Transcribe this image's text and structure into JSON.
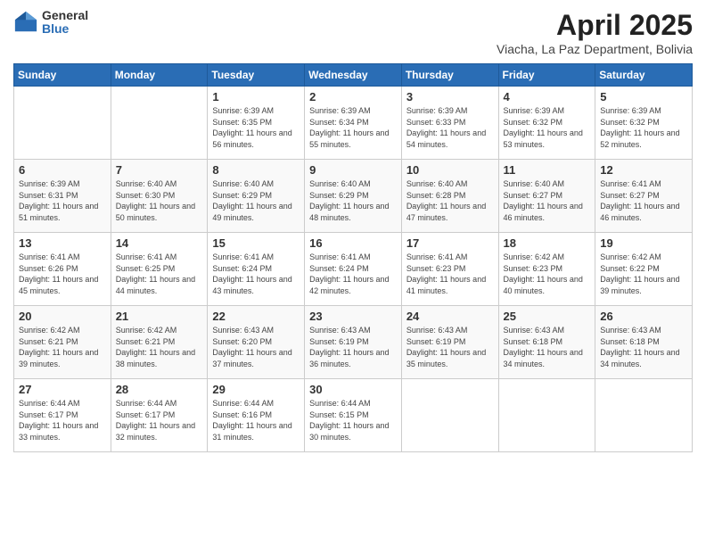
{
  "logo": {
    "general": "General",
    "blue": "Blue"
  },
  "header": {
    "month": "April 2025",
    "location": "Viacha, La Paz Department, Bolivia"
  },
  "weekdays": [
    "Sunday",
    "Monday",
    "Tuesday",
    "Wednesday",
    "Thursday",
    "Friday",
    "Saturday"
  ],
  "weeks": [
    [
      {
        "day": null,
        "sunrise": null,
        "sunset": null,
        "daylight": null
      },
      {
        "day": null,
        "sunrise": null,
        "sunset": null,
        "daylight": null
      },
      {
        "day": "1",
        "sunrise": "Sunrise: 6:39 AM",
        "sunset": "Sunset: 6:35 PM",
        "daylight": "Daylight: 11 hours and 56 minutes."
      },
      {
        "day": "2",
        "sunrise": "Sunrise: 6:39 AM",
        "sunset": "Sunset: 6:34 PM",
        "daylight": "Daylight: 11 hours and 55 minutes."
      },
      {
        "day": "3",
        "sunrise": "Sunrise: 6:39 AM",
        "sunset": "Sunset: 6:33 PM",
        "daylight": "Daylight: 11 hours and 54 minutes."
      },
      {
        "day": "4",
        "sunrise": "Sunrise: 6:39 AM",
        "sunset": "Sunset: 6:32 PM",
        "daylight": "Daylight: 11 hours and 53 minutes."
      },
      {
        "day": "5",
        "sunrise": "Sunrise: 6:39 AM",
        "sunset": "Sunset: 6:32 PM",
        "daylight": "Daylight: 11 hours and 52 minutes."
      }
    ],
    [
      {
        "day": "6",
        "sunrise": "Sunrise: 6:39 AM",
        "sunset": "Sunset: 6:31 PM",
        "daylight": "Daylight: 11 hours and 51 minutes."
      },
      {
        "day": "7",
        "sunrise": "Sunrise: 6:40 AM",
        "sunset": "Sunset: 6:30 PM",
        "daylight": "Daylight: 11 hours and 50 minutes."
      },
      {
        "day": "8",
        "sunrise": "Sunrise: 6:40 AM",
        "sunset": "Sunset: 6:29 PM",
        "daylight": "Daylight: 11 hours and 49 minutes."
      },
      {
        "day": "9",
        "sunrise": "Sunrise: 6:40 AM",
        "sunset": "Sunset: 6:29 PM",
        "daylight": "Daylight: 11 hours and 48 minutes."
      },
      {
        "day": "10",
        "sunrise": "Sunrise: 6:40 AM",
        "sunset": "Sunset: 6:28 PM",
        "daylight": "Daylight: 11 hours and 47 minutes."
      },
      {
        "day": "11",
        "sunrise": "Sunrise: 6:40 AM",
        "sunset": "Sunset: 6:27 PM",
        "daylight": "Daylight: 11 hours and 46 minutes."
      },
      {
        "day": "12",
        "sunrise": "Sunrise: 6:41 AM",
        "sunset": "Sunset: 6:27 PM",
        "daylight": "Daylight: 11 hours and 46 minutes."
      }
    ],
    [
      {
        "day": "13",
        "sunrise": "Sunrise: 6:41 AM",
        "sunset": "Sunset: 6:26 PM",
        "daylight": "Daylight: 11 hours and 45 minutes."
      },
      {
        "day": "14",
        "sunrise": "Sunrise: 6:41 AM",
        "sunset": "Sunset: 6:25 PM",
        "daylight": "Daylight: 11 hours and 44 minutes."
      },
      {
        "day": "15",
        "sunrise": "Sunrise: 6:41 AM",
        "sunset": "Sunset: 6:24 PM",
        "daylight": "Daylight: 11 hours and 43 minutes."
      },
      {
        "day": "16",
        "sunrise": "Sunrise: 6:41 AM",
        "sunset": "Sunset: 6:24 PM",
        "daylight": "Daylight: 11 hours and 42 minutes."
      },
      {
        "day": "17",
        "sunrise": "Sunrise: 6:41 AM",
        "sunset": "Sunset: 6:23 PM",
        "daylight": "Daylight: 11 hours and 41 minutes."
      },
      {
        "day": "18",
        "sunrise": "Sunrise: 6:42 AM",
        "sunset": "Sunset: 6:23 PM",
        "daylight": "Daylight: 11 hours and 40 minutes."
      },
      {
        "day": "19",
        "sunrise": "Sunrise: 6:42 AM",
        "sunset": "Sunset: 6:22 PM",
        "daylight": "Daylight: 11 hours and 39 minutes."
      }
    ],
    [
      {
        "day": "20",
        "sunrise": "Sunrise: 6:42 AM",
        "sunset": "Sunset: 6:21 PM",
        "daylight": "Daylight: 11 hours and 39 minutes."
      },
      {
        "day": "21",
        "sunrise": "Sunrise: 6:42 AM",
        "sunset": "Sunset: 6:21 PM",
        "daylight": "Daylight: 11 hours and 38 minutes."
      },
      {
        "day": "22",
        "sunrise": "Sunrise: 6:43 AM",
        "sunset": "Sunset: 6:20 PM",
        "daylight": "Daylight: 11 hours and 37 minutes."
      },
      {
        "day": "23",
        "sunrise": "Sunrise: 6:43 AM",
        "sunset": "Sunset: 6:19 PM",
        "daylight": "Daylight: 11 hours and 36 minutes."
      },
      {
        "day": "24",
        "sunrise": "Sunrise: 6:43 AM",
        "sunset": "Sunset: 6:19 PM",
        "daylight": "Daylight: 11 hours and 35 minutes."
      },
      {
        "day": "25",
        "sunrise": "Sunrise: 6:43 AM",
        "sunset": "Sunset: 6:18 PM",
        "daylight": "Daylight: 11 hours and 34 minutes."
      },
      {
        "day": "26",
        "sunrise": "Sunrise: 6:43 AM",
        "sunset": "Sunset: 6:18 PM",
        "daylight": "Daylight: 11 hours and 34 minutes."
      }
    ],
    [
      {
        "day": "27",
        "sunrise": "Sunrise: 6:44 AM",
        "sunset": "Sunset: 6:17 PM",
        "daylight": "Daylight: 11 hours and 33 minutes."
      },
      {
        "day": "28",
        "sunrise": "Sunrise: 6:44 AM",
        "sunset": "Sunset: 6:17 PM",
        "daylight": "Daylight: 11 hours and 32 minutes."
      },
      {
        "day": "29",
        "sunrise": "Sunrise: 6:44 AM",
        "sunset": "Sunset: 6:16 PM",
        "daylight": "Daylight: 11 hours and 31 minutes."
      },
      {
        "day": "30",
        "sunrise": "Sunrise: 6:44 AM",
        "sunset": "Sunset: 6:15 PM",
        "daylight": "Daylight: 11 hours and 30 minutes."
      },
      {
        "day": null,
        "sunrise": null,
        "sunset": null,
        "daylight": null
      },
      {
        "day": null,
        "sunrise": null,
        "sunset": null,
        "daylight": null
      },
      {
        "day": null,
        "sunrise": null,
        "sunset": null,
        "daylight": null
      }
    ]
  ]
}
